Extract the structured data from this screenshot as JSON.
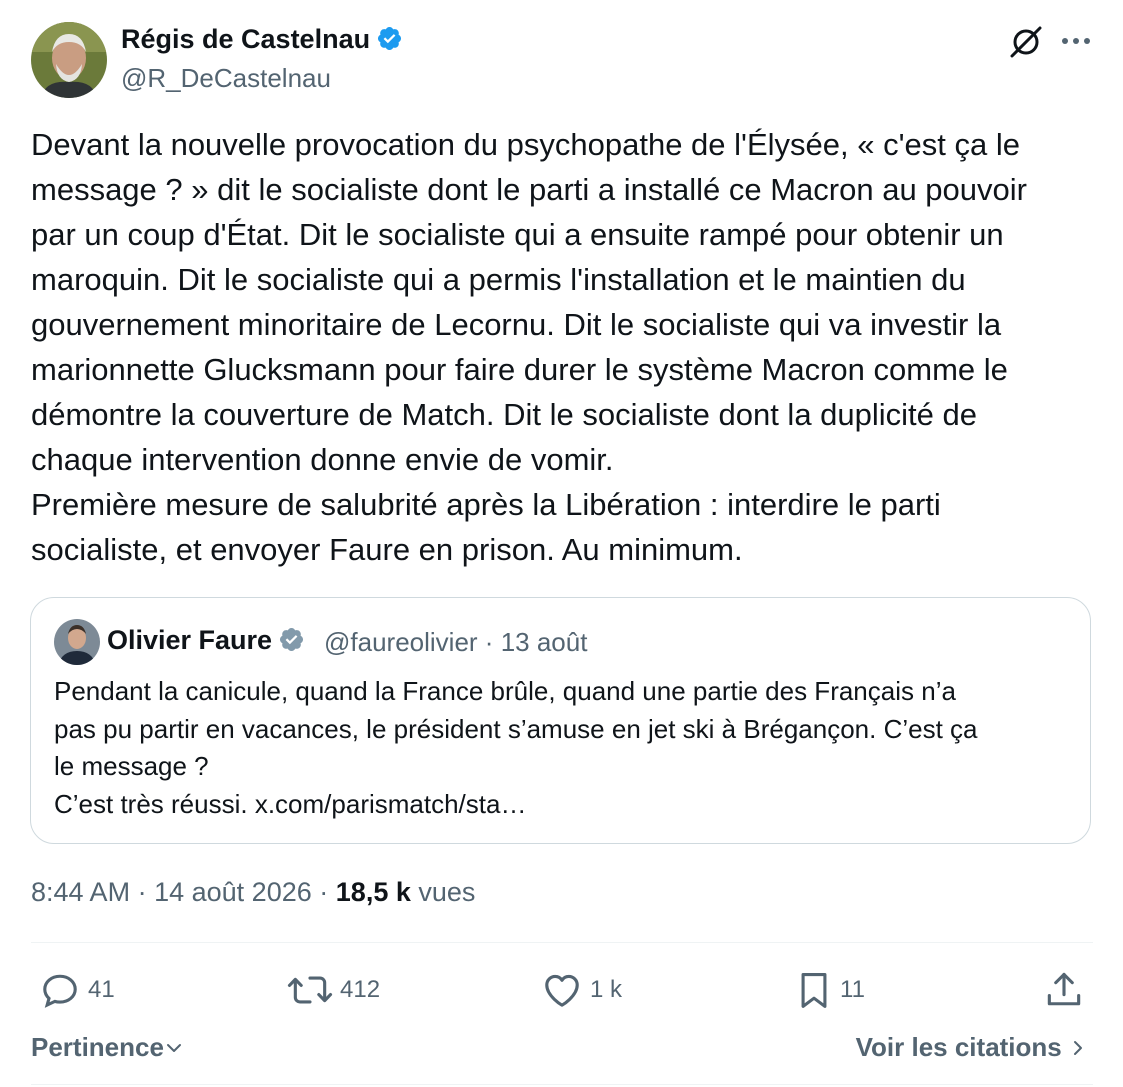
{
  "author": {
    "name": "Régis de Castelnau",
    "handle": "@R_DeCastelnau",
    "verified_color": "#1d9bf0"
  },
  "header_icons": [
    "grok-icon",
    "more-icon"
  ],
  "tweet": {
    "text": "Devant la nouvelle provocation du psychopathe de l'Élysée, « c'est ça le\nmessage ? » dit le socialiste dont le parti a installé ce Macron au pouvoir\npar un coup d'État. Dit le socialiste qui a ensuite rampé pour obtenir un\nmaroquin. Dit le socialiste qui a permis l'installation et le maintien du\ngouvernement minoritaire de Lecornu. Dit le socialiste qui va investir la\nmarionnette Glucksmann pour faire durer le système Macron comme le\ndémontre la couverture de Match. Dit le socialiste dont la duplicité de\nchaque intervention donne envie de vomir.\nPremière mesure de salubrité après la Libération : interdire le parti\nsocialiste, et envoyer Faure en prison. Au minimum."
  },
  "quote": {
    "name": "Olivier Faure",
    "handle": "@faureolivier",
    "date": "13 août",
    "separator": "·",
    "verified_color": "#829aab",
    "text": "Pendant la canicule, quand la France brûle, quand une partie des Français n’a\npas pu partir en vacances, le président s’amuse en jet ski à Brégançon. C’est ça\nle message ?\nC’est très réussi. x.com/parismatch/sta…"
  },
  "meta": {
    "time": "8:44 AM",
    "date": "14 août 2026",
    "sep": "·",
    "views_count": "18,5 k",
    "views_label": "vues"
  },
  "actions": {
    "replies": "41",
    "reposts": "412",
    "likes": "1 k",
    "bookmarks": "11"
  },
  "footer": {
    "sort_label": "Pertinence",
    "quotes_link": "Voir les citations"
  },
  "colors": {
    "text": "#0f1419",
    "secondary": "#536471",
    "border": "#cfd9de",
    "verified": "#1d9bf0"
  }
}
